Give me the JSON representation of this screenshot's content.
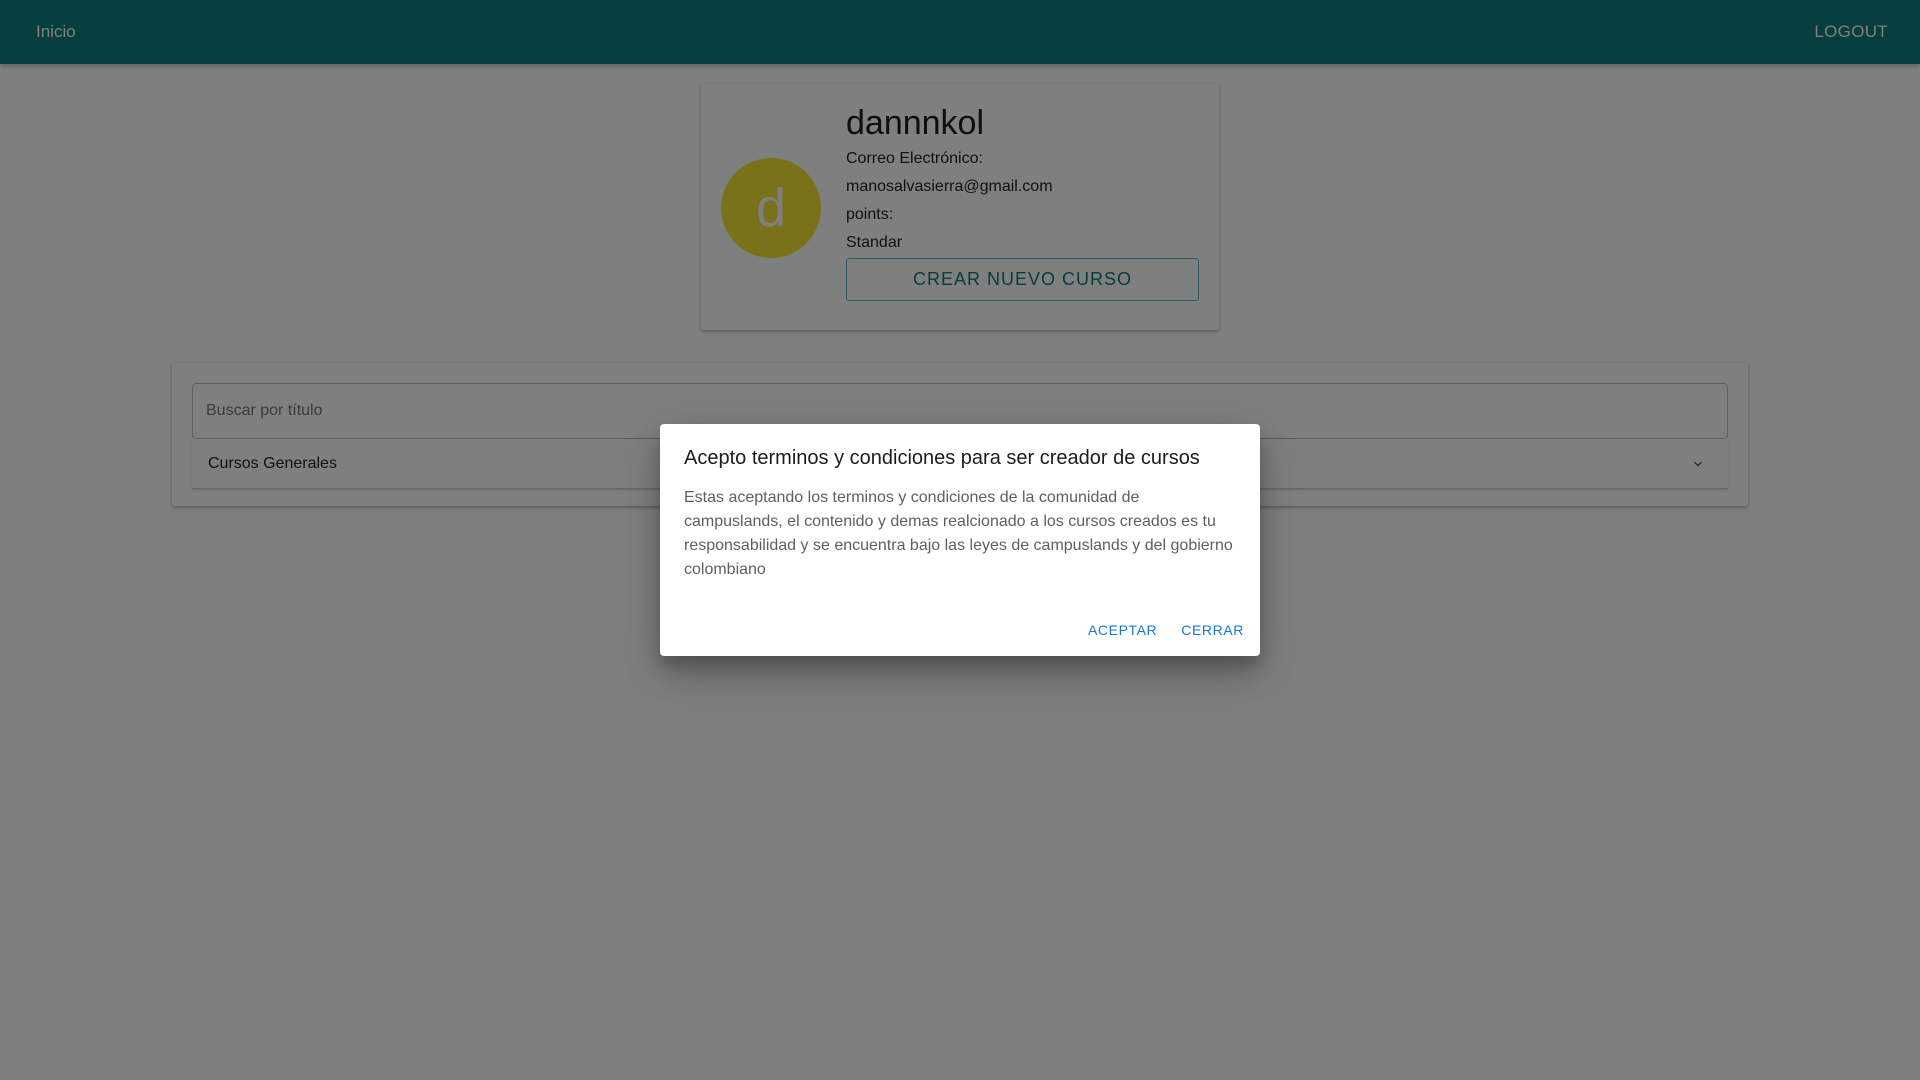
{
  "topbar": {
    "home_label": "Inicio",
    "logout_label": "LOGOUT"
  },
  "profile": {
    "avatar_letter": "d",
    "username": "dannnkol",
    "email_label": "Correo Electrónico:",
    "email": "manosalvasierra@gmail.com",
    "points_label": "points:",
    "plan": "Standar",
    "create_course_label": "CREAR NUEVO CURSO"
  },
  "courses": {
    "search_placeholder": "Buscar por título",
    "accordion_label": "Cursos Generales"
  },
  "dialog": {
    "title": "Acepto terminos y condiciones para ser creador de cursos",
    "text": "Estas aceptando los terminos y condiciones de la comunidad de campuslands, el contenido y demas realcionado a los cursos creados es tu responsabilidad y se encuentra bajo las leyes de campuslands y del gobierno colombiano",
    "accept_label": "ACEPTAR",
    "close_label": "CERRAR"
  },
  "colors": {
    "topbar": "#0c7c7b",
    "avatar": "#f2e531",
    "dialog_buttons": "#1976d2"
  },
  "icons": {
    "accordion_expand": "chevron-down-icon"
  }
}
